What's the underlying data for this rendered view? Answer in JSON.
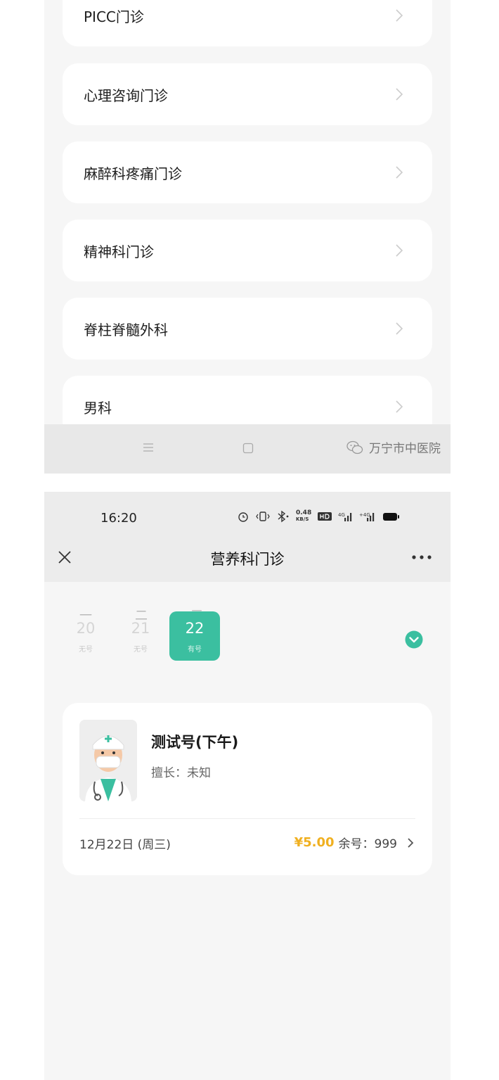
{
  "screen1": {
    "departments": [
      {
        "label": "PICC门诊"
      },
      {
        "label": "心理咨询门诊"
      },
      {
        "label": "麻醉科疼痛门诊"
      },
      {
        "label": "精神科门诊"
      },
      {
        "label": "脊柱脊髓外科"
      },
      {
        "label": "男科"
      }
    ],
    "watermark": "万宁市中医院"
  },
  "screen2": {
    "status": {
      "time": "16:20",
      "net_speed": "0.48",
      "net_unit": "KB/S"
    },
    "title": "营养科门诊",
    "week": [
      "一",
      "二",
      "三"
    ],
    "dates": [
      {
        "num": "20",
        "status": "无号"
      },
      {
        "num": "21",
        "status": "无号"
      },
      {
        "num": "22",
        "status": "有号"
      }
    ],
    "selected_date_index": 2,
    "doctor": {
      "name": "测试号(下午)",
      "specialty": "擅长：未知",
      "date": "12月22日 (周三)",
      "price": "¥5.00",
      "remaining": "余号：999"
    }
  },
  "colors": {
    "accent": "#3bbfa0",
    "price": "#f0b020",
    "background": "#f6f6f6"
  }
}
